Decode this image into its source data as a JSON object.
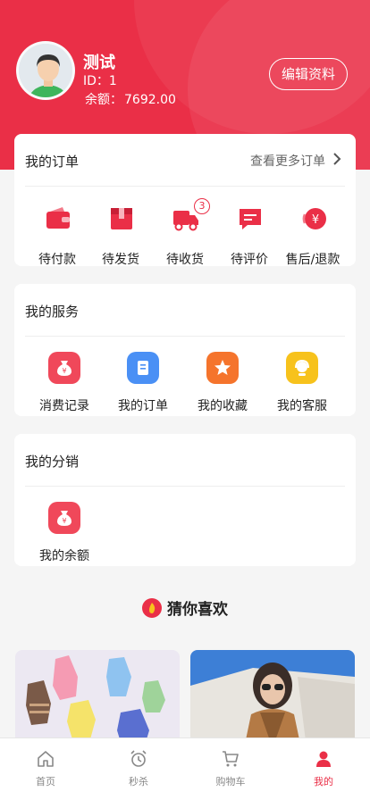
{
  "profile": {
    "name": "测试",
    "id_text": "ID：1",
    "balance_label": "余额：",
    "balance_value": "7692.00",
    "edit_label": "编辑资料"
  },
  "orders": {
    "title": "我的订单",
    "more_label": "查看更多订单",
    "items": [
      {
        "label": "待付款",
        "icon": "wallet-icon"
      },
      {
        "label": "待发货",
        "icon": "package-icon"
      },
      {
        "label": "待收货",
        "icon": "truck-icon",
        "badge": "3"
      },
      {
        "label": "待评价",
        "icon": "comment-icon"
      },
      {
        "label": "售后/退款",
        "icon": "refund-icon"
      }
    ]
  },
  "services": {
    "title": "我的服务",
    "items": [
      {
        "label": "消费记录",
        "icon": "money-bag-icon",
        "color": "#f0485a"
      },
      {
        "label": "我的订单",
        "icon": "document-icon",
        "color": "#4a90f5"
      },
      {
        "label": "我的收藏",
        "icon": "star-icon",
        "color": "#f5742c"
      },
      {
        "label": "我的客服",
        "icon": "customer-service-icon",
        "color": "#f7c21c"
      }
    ]
  },
  "distribution": {
    "title": "我的分销",
    "items": [
      {
        "label": "我的余额",
        "icon": "money-bag-icon",
        "color": "#f0485a"
      }
    ]
  },
  "guess": {
    "title": "猜你喜欢"
  },
  "tabbar": [
    {
      "label": "首页",
      "icon": "home-icon",
      "active": false
    },
    {
      "label": "秒杀",
      "icon": "alarm-clock-icon",
      "active": false
    },
    {
      "label": "购物车",
      "icon": "cart-icon",
      "active": false
    },
    {
      "label": "我的",
      "icon": "user-icon",
      "active": true
    }
  ],
  "colors": {
    "accent": "#ea2f47",
    "background": "#f5f5f5"
  }
}
